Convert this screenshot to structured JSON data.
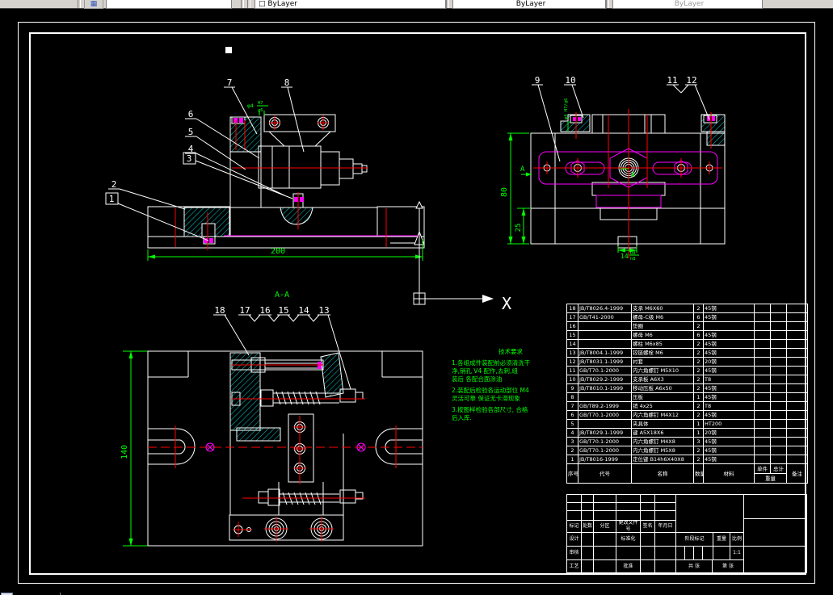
{
  "toolbar": {
    "color": "ByLayer",
    "linetype": "ByLayer",
    "lineweight": "ByLayer"
  },
  "colors": {
    "line": "#ffffff",
    "center": "#ff0000",
    "hatch": "#00ffff",
    "aux": "#ff00ff",
    "dim": "#00ff00"
  },
  "views": {
    "front": {
      "callouts": [
        "1",
        "2",
        "3",
        "4",
        "5",
        "6",
        "7",
        "8"
      ],
      "dim_width": "200",
      "fit_dia": "φ4",
      "fit_upper": "H7",
      "fit_lower": "g6"
    },
    "plan": {
      "callouts": [
        "9",
        "10",
        "11",
        "12"
      ],
      "dim_height": "80",
      "dim_offset": "25",
      "key_size": "14",
      "key_upper": "D8",
      "key_lower": "h8",
      "section_letter": "A",
      "hole_fit": "φ4 H7/g6"
    },
    "section": {
      "title": "A-A",
      "callouts": [
        "13",
        "14",
        "15",
        "16",
        "17",
        "18"
      ],
      "dim_height": "140"
    },
    "axis_label": "X"
  },
  "notes": {
    "title": "技术要求",
    "lines": [
      "1.各组成件装配前必须清洗干",
      "净,销孔 V4 配作,去刺,组",
      "装后 各配合面涂油",
      "2.装配后检验各运动部位 M4",
      "灵活可靠 保证无卡滞现象",
      "3.按图样检验各部尺寸, 合格",
      "后入库."
    ]
  },
  "bom": {
    "header": {
      "no": "序号",
      "code": "代号",
      "name": "名称",
      "qty": "数量",
      "mat": "材料",
      "single": "单件",
      "total": "总计",
      "weight": "重量",
      "remark": "备注"
    },
    "rows": [
      [
        "18",
        "JB/T8026.4-1999",
        "支承 M6X60",
        "2",
        "45钢",
        "",
        "",
        ""
      ],
      [
        "17",
        "GB/T41-2000",
        "螺母-C级 M6",
        "6",
        "45钢",
        "",
        "",
        ""
      ],
      [
        "16",
        "",
        "垫圈",
        "2",
        "",
        "",
        "",
        ""
      ],
      [
        "15",
        "",
        "螺母 M6",
        "6",
        "45钢",
        "",
        "",
        ""
      ],
      [
        "14",
        "",
        "螺柱 M6x85",
        "2",
        "45钢",
        "",
        "",
        ""
      ],
      [
        "13",
        "JB/T8004.1-1999",
        "铰链螺栓 M6",
        "2",
        "45钢",
        "",
        "",
        ""
      ],
      [
        "12",
        "JB/T8031.1-1999",
        "衬套",
        "2",
        "20钢",
        "",
        "",
        ""
      ],
      [
        "11",
        "GB/T70.1-2000",
        "内六角螺钉 M5X10",
        "2",
        "45钢",
        "",
        "",
        ""
      ],
      [
        "10",
        "JB/T8029.2-1999",
        "支承板 A6X3",
        "2",
        "T8",
        "",
        "",
        ""
      ],
      [
        "9",
        "JB/T8010.1-1999",
        "移动压板 A6x50",
        "2",
        "45钢",
        "",
        "",
        ""
      ],
      [
        "8",
        "",
        "压板",
        "1",
        "45钢",
        "",
        "",
        ""
      ],
      [
        "7",
        "GB/T89.2-1999",
        "销 4x25",
        "2",
        "T8",
        "",
        "",
        ""
      ],
      [
        "6",
        "GB/T70.1-2000",
        "内六角螺钉 M4X12",
        "2",
        "45钢",
        "",
        "",
        ""
      ],
      [
        "5",
        "",
        "夹具体",
        "1",
        "HT200",
        "",
        "",
        ""
      ],
      [
        "4",
        "JB/T8029.1-1999",
        "键 A5X18X6",
        "1",
        "20钢",
        "",
        "",
        ""
      ],
      [
        "3",
        "GB/T70.1-2000",
        "内六角螺钉 M4X8",
        "3",
        "45钢",
        "",
        "",
        ""
      ],
      [
        "2",
        "GB/T70.1-2000",
        "内六角螺钉 M5X8",
        "2",
        "45钢",
        "",
        "",
        ""
      ],
      [
        "1",
        "JB/T8016-1999",
        "定位键 B14h6X40X8",
        "2",
        "45钢",
        "",
        "",
        ""
      ]
    ]
  },
  "titleblock": {
    "mark": "标记",
    "count": "处数",
    "zone": "分区",
    "doc": "更改文件号",
    "sign": "签名",
    "date": "年月日",
    "design": "设计",
    "check": "审核",
    "process": "工艺",
    "standard": "标准化",
    "approve": "批准",
    "stage": "阶段标记",
    "weight": "重量",
    "scale_label": "比例",
    "scale_value": "1:1",
    "sheets": "共 张",
    "sheet_no": "第 张"
  }
}
